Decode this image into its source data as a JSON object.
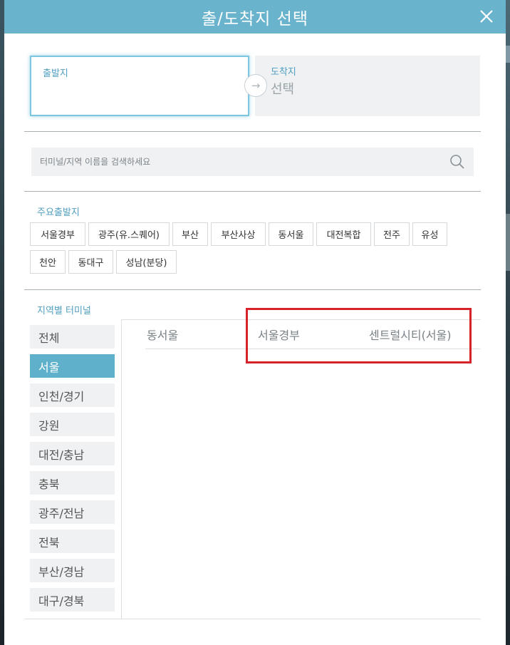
{
  "header": {
    "title": "출/도착지 선택",
    "close_icon": "close-icon"
  },
  "route": {
    "departure_label": "출발지",
    "departure_value": "",
    "arrival_label": "도착지",
    "arrival_value": "선택"
  },
  "search": {
    "placeholder": "터미널/지역 이름을 검색하세요",
    "value": ""
  },
  "popular": {
    "title": "주요출발지",
    "items": [
      "서울경부",
      "광주(유.스퀘어)",
      "부산",
      "부산사상",
      "동서울",
      "대전복합",
      "전주",
      "유성",
      "천안",
      "동대구",
      "성남(분당)"
    ]
  },
  "regional": {
    "title": "지역별 터미널",
    "regions": [
      "전체",
      "서울",
      "인천/경기",
      "강원",
      "대전/충남",
      "충북",
      "광주/전남",
      "전북",
      "부산/경남",
      "대구/경북"
    ],
    "selected_region": "서울",
    "terminals": [
      "동서울",
      "서울경부",
      "센트럴시티(서울)"
    ]
  },
  "colors": {
    "accent": "#6ab3cd",
    "active_region": "#5fb0cb",
    "label": "#4f9ec0",
    "highlight": "#d6232b"
  }
}
